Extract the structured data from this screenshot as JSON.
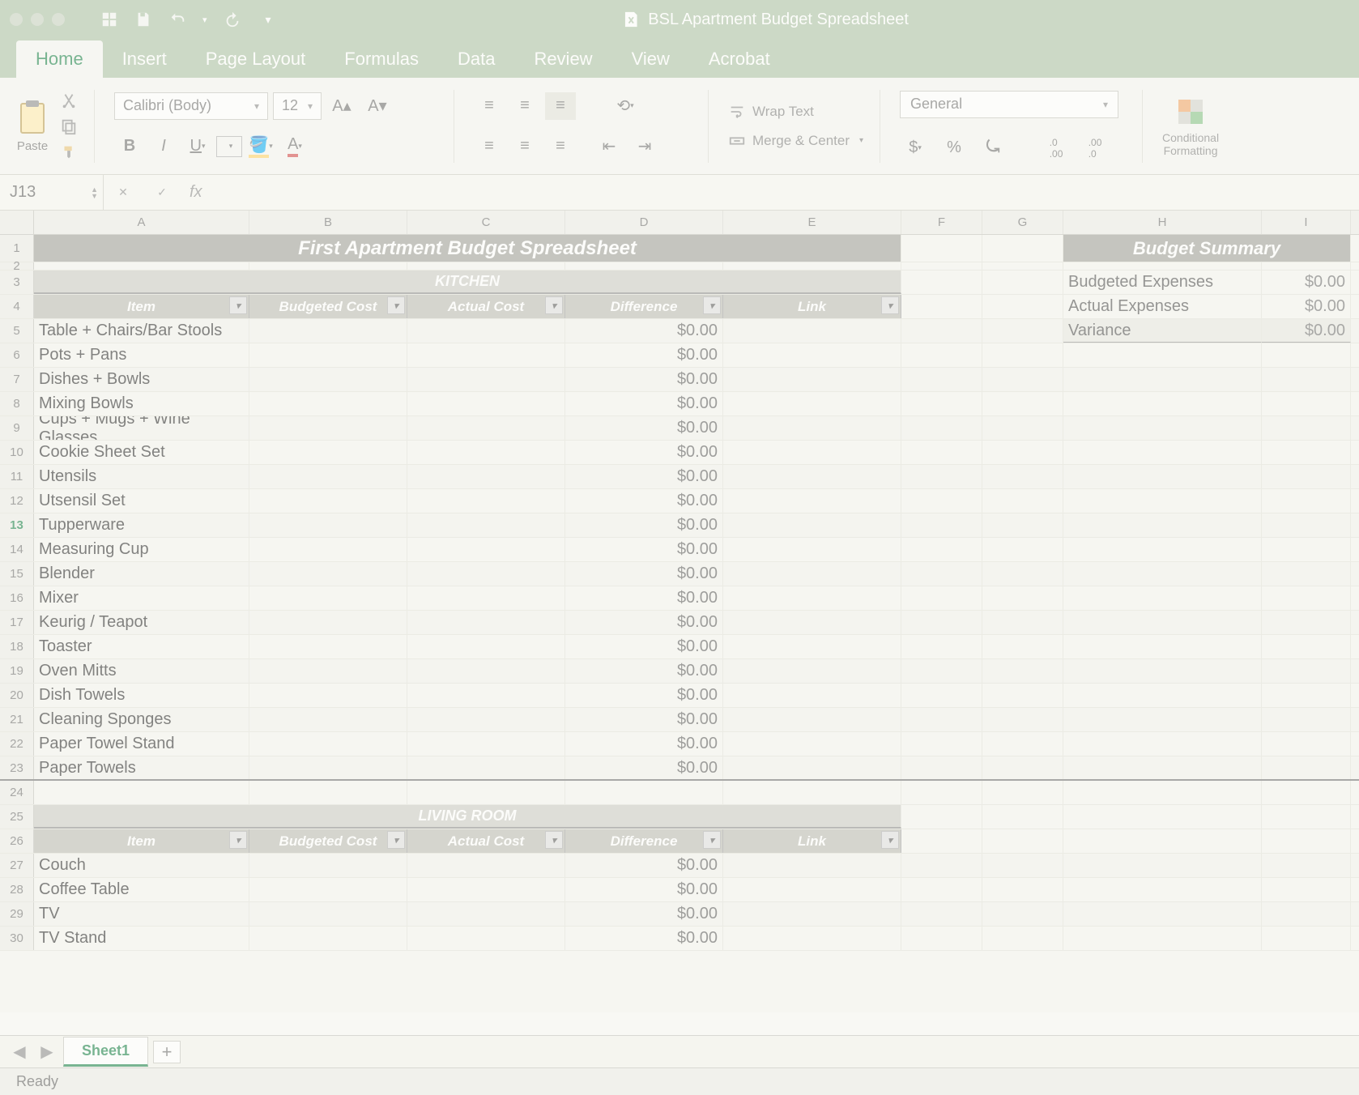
{
  "window": {
    "title": "BSL Apartment Budget Spreadsheet"
  },
  "ribbon": {
    "tabs": [
      "Home",
      "Insert",
      "Page Layout",
      "Formulas",
      "Data",
      "Review",
      "View",
      "Acrobat"
    ],
    "active_tab": "Home",
    "paste_label": "Paste",
    "font_name": "Calibri (Body)",
    "font_size": "12",
    "wrap_text": "Wrap Text",
    "merge_center": "Merge & Center",
    "number_format": "General",
    "cond_fmt": "Conditional\nFormatting"
  },
  "name_box": "J13",
  "columns": [
    "A",
    "B",
    "C",
    "D",
    "E",
    "F",
    "G",
    "H",
    "I"
  ],
  "title_row_text": "First Apartment Budget Spreadsheet",
  "sections": {
    "kitchen": "KITCHEN",
    "living_room": "LIVING ROOM"
  },
  "table_headers": {
    "item": "Item",
    "budgeted": "Budgeted Cost",
    "actual": "Actual Cost",
    "diff": "Difference",
    "link": "Link"
  },
  "kitchen_rows": [
    {
      "n": "5",
      "item": "Table + Chairs/Bar Stools",
      "diff": "$0.00"
    },
    {
      "n": "6",
      "item": "Pots + Pans",
      "diff": "$0.00"
    },
    {
      "n": "7",
      "item": "Dishes + Bowls",
      "diff": "$0.00"
    },
    {
      "n": "8",
      "item": "Mixing Bowls",
      "diff": "$0.00"
    },
    {
      "n": "9",
      "item": "Cups + Mugs + Wine Glasses",
      "diff": "$0.00"
    },
    {
      "n": "10",
      "item": "Cookie Sheet Set",
      "diff": "$0.00"
    },
    {
      "n": "11",
      "item": "Utensils",
      "diff": "$0.00"
    },
    {
      "n": "12",
      "item": "Utsensil Set",
      "diff": "$0.00"
    },
    {
      "n": "13",
      "item": "Tupperware",
      "diff": "$0.00",
      "active": true
    },
    {
      "n": "14",
      "item": "Measuring Cup",
      "diff": "$0.00"
    },
    {
      "n": "15",
      "item": "Blender",
      "diff": "$0.00"
    },
    {
      "n": "16",
      "item": "Mixer",
      "diff": "$0.00"
    },
    {
      "n": "17",
      "item": "Keurig / Teapot",
      "diff": "$0.00"
    },
    {
      "n": "18",
      "item": "Toaster",
      "diff": "$0.00"
    },
    {
      "n": "19",
      "item": "Oven Mitts",
      "diff": "$0.00"
    },
    {
      "n": "20",
      "item": "Dish Towels",
      "diff": "$0.00"
    },
    {
      "n": "21",
      "item": "Cleaning Sponges",
      "diff": "$0.00"
    },
    {
      "n": "22",
      "item": "Paper Towel Stand",
      "diff": "$0.00"
    },
    {
      "n": "23",
      "item": "Paper Towels",
      "diff": "$0.00"
    }
  ],
  "living_rows": [
    {
      "n": "27",
      "item": "Couch",
      "diff": "$0.00"
    },
    {
      "n": "28",
      "item": "Coffee Table",
      "diff": "$0.00"
    },
    {
      "n": "29",
      "item": "TV",
      "diff": "$0.00"
    },
    {
      "n": "30",
      "item": "TV Stand",
      "diff": "$0.00"
    }
  ],
  "summary": {
    "title": "Budget Summary",
    "rows": [
      {
        "label": "Budgeted Expenses",
        "val": "$0.00"
      },
      {
        "label": "Actual Expenses",
        "val": "$0.00"
      },
      {
        "label": "Variance",
        "val": "$0.00",
        "variance": true
      }
    ]
  },
  "sheet_tab": "Sheet1",
  "status_text": "Ready"
}
